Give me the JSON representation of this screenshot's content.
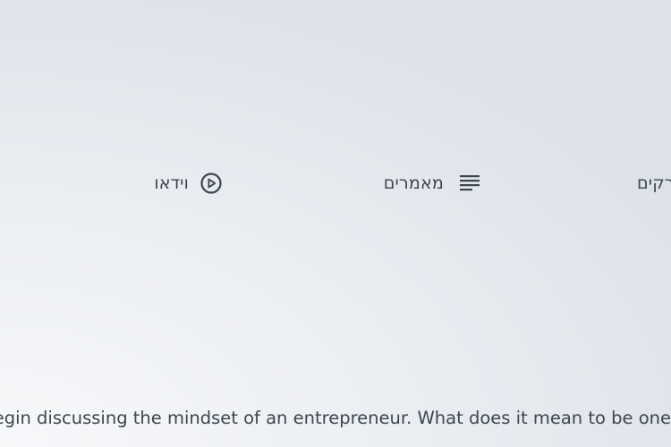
{
  "tabs": [
    {
      "label": "וידאו",
      "icon": "play-circle-icon"
    },
    {
      "label": "מאמרים",
      "icon": "text-lines-icon"
    },
    {
      "label": "פרקים",
      "icon": ""
    }
  ],
  "description": "In this episode we begin discussing the mindset of an entrepreneur. What does it mean to be one"
}
